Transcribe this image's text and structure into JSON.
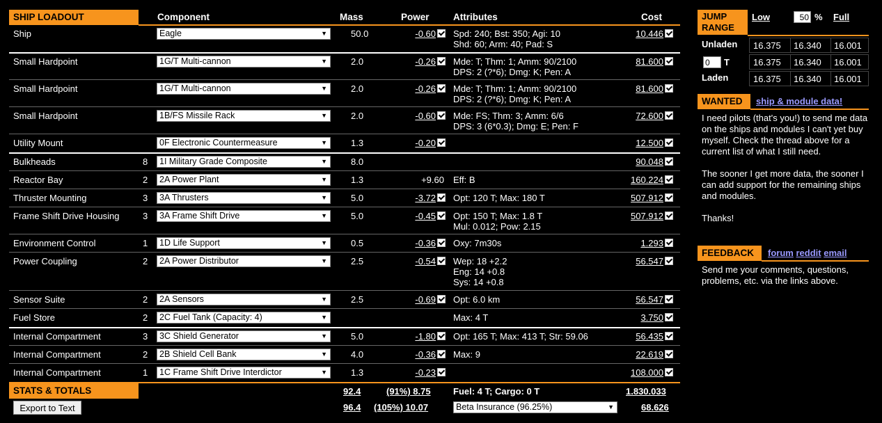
{
  "header": {
    "title": "SHIP LOADOUT",
    "component": "Component",
    "mass": "Mass",
    "power": "Power",
    "attributes": "Attributes",
    "cost": "Cost"
  },
  "rows": [
    {
      "slot": "Ship",
      "size": "",
      "component": "Eagle",
      "mass": "50.0",
      "power": "-0.60",
      "power_check": true,
      "attr1": "Spd: 240; Bst: 350; Agi: 10",
      "attr2": "Shd: 60; Arm: 40; Pad: S",
      "attr3": "",
      "cost": "10.446",
      "cost_check": true
    },
    {
      "slot": "Small Hardpoint",
      "size": "",
      "component": "1G/T Multi-cannon",
      "mass": "2.0",
      "power": "-0.26",
      "power_check": true,
      "attr1": "Mde: T; Thm: 1; Amm: 90/2100",
      "attr2": "DPS: 2 (?*6); Dmg: K; Pen: A",
      "attr3": "",
      "cost": "81.600",
      "cost_check": true
    },
    {
      "slot": "Small Hardpoint",
      "size": "",
      "component": "1G/T Multi-cannon",
      "mass": "2.0",
      "power": "-0.26",
      "power_check": true,
      "attr1": "Mde: T; Thm: 1; Amm: 90/2100",
      "attr2": "DPS: 2 (?*6); Dmg: K; Pen: A",
      "attr3": "",
      "cost": "81.600",
      "cost_check": true
    },
    {
      "slot": "Small Hardpoint",
      "size": "",
      "component": "1B/FS Missile Rack",
      "mass": "2.0",
      "power": "-0.60",
      "power_check": true,
      "attr1": "Mde: FS; Thm: 3; Amm: 6/6",
      "attr2": "DPS: 3 (6*0.3); Dmg: E; Pen: F",
      "attr3": "",
      "cost": "72.600",
      "cost_check": true
    },
    {
      "slot": "Utility Mount",
      "size": "",
      "component": "0F Electronic Countermeasure",
      "mass": "1.3",
      "power": "-0.20",
      "power_check": true,
      "attr1": "",
      "attr2": "",
      "attr3": "",
      "cost": "12.500",
      "cost_check": true
    },
    {
      "slot": "Bulkheads",
      "size": "8",
      "component": "1I Military Grade Composite",
      "mass": "8.0",
      "power": "",
      "power_check": false,
      "attr1": "",
      "attr2": "",
      "attr3": "",
      "cost": "90.048",
      "cost_check": true
    },
    {
      "slot": "Reactor Bay",
      "size": "2",
      "component": "2A Power Plant",
      "mass": "1.3",
      "power": "+9.60",
      "power_check": false,
      "attr1": "Eff: B",
      "attr2": "",
      "attr3": "",
      "cost": "160.224",
      "cost_check": true
    },
    {
      "slot": "Thruster Mounting",
      "size": "3",
      "component": "3A Thrusters",
      "mass": "5.0",
      "power": "-3.72",
      "power_check": true,
      "attr1": "Opt: 120 T; Max: 180 T",
      "attr2": "",
      "attr3": "",
      "cost": "507.912",
      "cost_check": true
    },
    {
      "slot": "Frame Shift Drive Housing",
      "size": "3",
      "component": "3A Frame Shift Drive",
      "mass": "5.0",
      "power": "-0.45",
      "power_check": true,
      "attr1": "Opt: 150 T; Max: 1.8 T",
      "attr2": "Mul: 0.012; Pow: 2.15",
      "attr3": "",
      "cost": "507.912",
      "cost_check": true
    },
    {
      "slot": "Environment Control",
      "size": "1",
      "component": "1D Life Support",
      "mass": "0.5",
      "power": "-0.36",
      "power_check": true,
      "attr1": "Oxy: 7m30s",
      "attr2": "",
      "attr3": "",
      "cost": "1.293",
      "cost_check": true
    },
    {
      "slot": "Power Coupling",
      "size": "2",
      "component": "2A Power Distributor",
      "mass": "2.5",
      "power": "-0.54",
      "power_check": true,
      "attr1": "Wep: 18 +2.2",
      "attr2": "Eng: 14 +0.8",
      "attr3": "Sys: 14 +0.8",
      "cost": "56.547",
      "cost_check": true
    },
    {
      "slot": "Sensor Suite",
      "size": "2",
      "component": "2A Sensors",
      "mass": "2.5",
      "power": "-0.69",
      "power_check": true,
      "attr1": "Opt: 6.0 km",
      "attr2": "",
      "attr3": "",
      "cost": "56.547",
      "cost_check": true
    },
    {
      "slot": "Fuel Store",
      "size": "2",
      "component": "2C Fuel Tank (Capacity: 4)",
      "mass": "",
      "power": "",
      "power_check": false,
      "attr1": "Max: 4 T",
      "attr2": "",
      "attr3": "",
      "cost": "3.750",
      "cost_check": true
    },
    {
      "slot": "Internal Compartment",
      "size": "3",
      "component": "3C Shield Generator",
      "mass": "5.0",
      "power": "-1.80",
      "power_check": true,
      "attr1": "Opt: 165 T; Max: 413 T; Str: 59.06",
      "attr2": "",
      "attr3": "",
      "cost": "56.435",
      "cost_check": true
    },
    {
      "slot": "Internal Compartment",
      "size": "2",
      "component": "2B Shield Cell Bank",
      "mass": "4.0",
      "power": "-0.36",
      "power_check": true,
      "attr1": "Max: 9",
      "attr2": "",
      "attr3": "",
      "cost": "22.619",
      "cost_check": true
    },
    {
      "slot": "Internal Compartment",
      "size": "1",
      "component": "1C Frame Shift Drive Interdictor",
      "mass": "1.3",
      "power": "-0.23",
      "power_check": true,
      "attr1": "",
      "attr2": "",
      "attr3": "",
      "cost": "108.000",
      "cost_check": true
    }
  ],
  "totals": {
    "title": "STATS & TOTALS",
    "mass1": "92.4",
    "power1": "(91%) 8.75",
    "fuel": "Fuel: 4 T; Cargo: 0 T",
    "cost1": "1.830.033",
    "export": "Export to Text",
    "mass2": "96.4",
    "power2": "(105%) 10.07",
    "insurance": "Beta Insurance (96.25%)",
    "cost2": "68.626"
  },
  "jump": {
    "title1": "JUMP",
    "title2": "RANGE",
    "low": "Low",
    "pct_value": "50",
    "pct": "%",
    "full": "Full",
    "rows": [
      {
        "label": "Unladen",
        "v": [
          "16.375",
          "16.340",
          "16.001"
        ]
      },
      {
        "label": "T",
        "input": "0",
        "v": [
          "16.375",
          "16.340",
          "16.001"
        ]
      },
      {
        "label": "Laden",
        "v": [
          "16.375",
          "16.340",
          "16.001"
        ]
      }
    ]
  },
  "wanted": {
    "title": "WANTED",
    "link": "ship & module data!",
    "p1": "I need pilots (that's you!) to send me data on the ships and modules I can't yet buy myself. Check the thread above for a current list of what I still need.",
    "p2": "The sooner I get more data, the sooner I can add support for the remaining ships and modules.",
    "p3": "Thanks!"
  },
  "feedback": {
    "title": "FEEDBACK",
    "forum": "forum",
    "reddit": "reddit",
    "email": "email",
    "text": "Send me your comments, questions, problems, etc. via the links above."
  }
}
